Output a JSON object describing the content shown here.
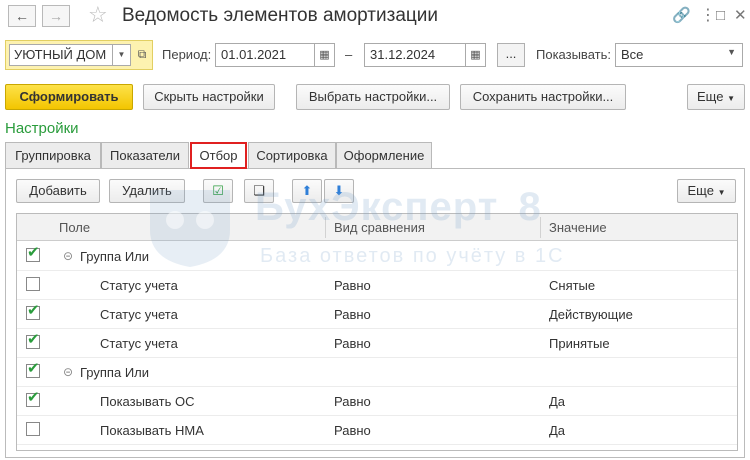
{
  "window": {
    "title": "Ведомость элементов амортизации"
  },
  "params": {
    "organization": "УЮТНЫЙ ДОМ",
    "period_label": "Период:",
    "date_from": "01.01.2021",
    "date_separator": "–",
    "date_to": "31.12.2024",
    "dots_label": "...",
    "show_label": "Показывать:",
    "show_value": "Все"
  },
  "toolbar": {
    "generate": "Сформировать",
    "hide_settings": "Скрыть настройки",
    "select_settings": "Выбрать настройки...",
    "save_settings": "Сохранить настройки...",
    "more": "Еще"
  },
  "settings_label": "Настройки",
  "tabs": [
    {
      "label": "Группировка"
    },
    {
      "label": "Показатели"
    },
    {
      "label": "Отбор"
    },
    {
      "label": "Сортировка"
    },
    {
      "label": "Оформление"
    }
  ],
  "panel_toolbar": {
    "add": "Добавить",
    "delete": "Удалить",
    "more": "Еще"
  },
  "grid": {
    "columns": [
      "Поле",
      "Вид сравнения",
      "Значение"
    ],
    "rows": [
      {
        "checked": true,
        "group": true,
        "field": "Группа Или",
        "compare": "",
        "value": ""
      },
      {
        "checked": false,
        "group": false,
        "field": "Статус учета",
        "compare": "Равно",
        "value": "Снятые"
      },
      {
        "checked": true,
        "group": false,
        "field": "Статус учета",
        "compare": "Равно",
        "value": "Действующие"
      },
      {
        "checked": true,
        "group": false,
        "field": "Статус учета",
        "compare": "Равно",
        "value": "Принятые"
      },
      {
        "checked": true,
        "group": true,
        "field": "Группа Или",
        "compare": "",
        "value": ""
      },
      {
        "checked": true,
        "group": false,
        "field": "Показывать ОС",
        "compare": "Равно",
        "value": "Да"
      },
      {
        "checked": false,
        "group": false,
        "field": "Показывать НМА",
        "compare": "Равно",
        "value": "Да"
      }
    ]
  },
  "watermark": {
    "main": "БухЭксперт",
    "digit": "8",
    "sub": "База ответов по учёту в 1С"
  },
  "colors": {
    "accent_green": "#2a9c3c",
    "primary_yellow": "#f3c500",
    "active_tab_border": "#e02020"
  }
}
